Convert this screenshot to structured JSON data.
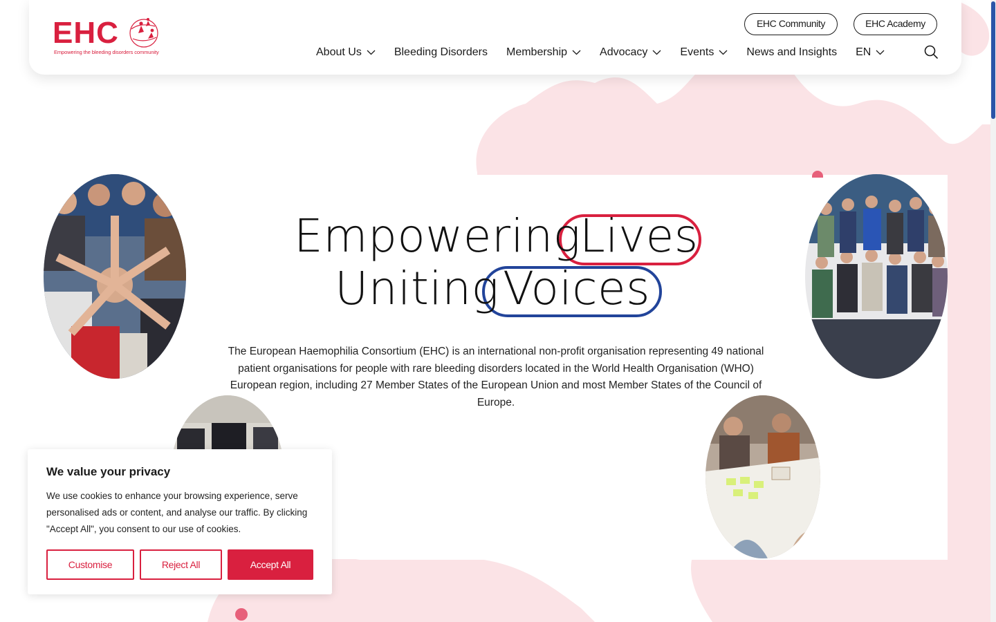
{
  "header": {
    "logo": {
      "text": "EHC",
      "tagline": "Empowering the bleeding disorders community"
    },
    "pills": {
      "community": "EHC Community",
      "academy": "EHC Academy"
    },
    "nav": [
      {
        "label": "About Us",
        "has_dropdown": true
      },
      {
        "label": "Bleeding Disorders",
        "has_dropdown": false
      },
      {
        "label": "Membership",
        "has_dropdown": true
      },
      {
        "label": "Advocacy",
        "has_dropdown": true
      },
      {
        "label": "Events",
        "has_dropdown": true
      },
      {
        "label": "News and Insights",
        "has_dropdown": false
      },
      {
        "label": "EN",
        "has_dropdown": true
      }
    ],
    "search_icon": "search-icon"
  },
  "hero": {
    "line1": "Empowering",
    "word1": "Lives",
    "line2": "Uniting",
    "word2": "Voices",
    "intro": "The European Haemophilia Consortium (EHC) is an international non-profit organisation representing 49 national patient organisations for people with rare bleeding disorders located in the World Health Organisation (WHO) European region, including 27 Member States of the European Union and most Member States of the Council of Europe.",
    "colors": {
      "lives": "#d9203f",
      "voices": "#22449a"
    }
  },
  "cookie": {
    "title": "We value your privacy",
    "text": "We use cookies to enhance your browsing experience, serve personalised ads or content, and analyse our traffic. By clicking \"Accept All\", you consent to our use of cookies.",
    "customise": "Customise",
    "reject": "Reject All",
    "accept": "Accept All"
  },
  "colors": {
    "brand": "#d9203f",
    "accent_blue": "#22449a",
    "blob": "#fbe3e6"
  }
}
